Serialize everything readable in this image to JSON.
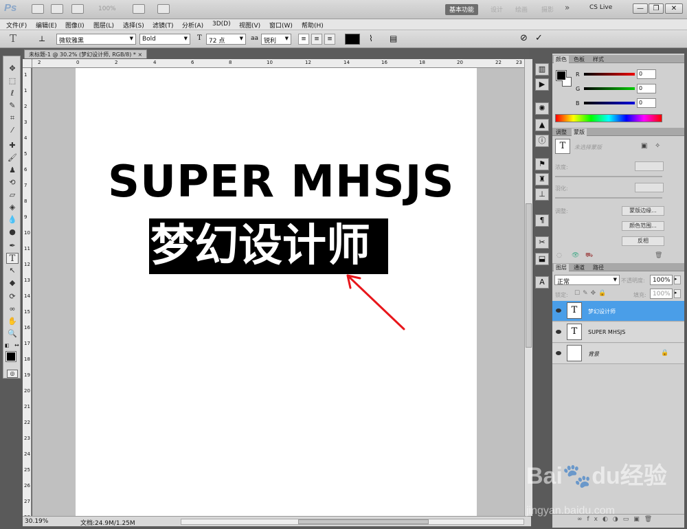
{
  "window": {
    "logo": "Ps",
    "zoom_dropdown": "100%",
    "workspaces": [
      "基本功能",
      "设计",
      "绘画",
      "摄影"
    ],
    "more": "»",
    "cs_live": "CS Live",
    "win_buttons": [
      "—",
      "❐",
      "✕"
    ]
  },
  "menu": [
    "文件(F)",
    "编辑(E)",
    "图像(I)",
    "图层(L)",
    "选择(S)",
    "滤镜(T)",
    "分析(A)",
    "3D(D)",
    "视图(V)",
    "窗口(W)",
    "帮助(H)"
  ],
  "options": {
    "font_family": "微软雅黑",
    "font_style": "Bold",
    "font_size": "72 点",
    "aa_label": "aa",
    "antialias": "锐利",
    "cancel": "⊘",
    "commit": "✓"
  },
  "document": {
    "tab_title": "未标题-1 @ 30.2% (梦幻设计师, RGB/8) *",
    "close": "×",
    "ruler_top": [
      "2",
      "0",
      "2",
      "4",
      "6",
      "8",
      "10",
      "12",
      "14",
      "16",
      "18",
      "20",
      "22",
      "23"
    ],
    "ruler_left": [
      "1",
      "1",
      "2",
      "3",
      "4",
      "5",
      "6",
      "7",
      "8",
      "9",
      "10",
      "11",
      "12",
      "13",
      "14",
      "15",
      "16",
      "17",
      "18",
      "19",
      "20",
      "21",
      "22",
      "23",
      "24",
      "25",
      "26",
      "27",
      "28"
    ],
    "line1": "SUPER MHSJS",
    "line2": "梦幻设计师"
  },
  "status": {
    "zoom": "30.19%",
    "doc_size": "文档:24.9M/1.25M"
  },
  "color_panel": {
    "tabs": [
      "颜色",
      "色板",
      "样式"
    ],
    "channels": [
      {
        "label": "R",
        "value": "0"
      },
      {
        "label": "G",
        "value": "0"
      },
      {
        "label": "B",
        "value": "0"
      }
    ]
  },
  "adjust_panel": {
    "tabs": [
      "调整",
      "蒙版"
    ],
    "mask_hint": "未选择蒙版",
    "density": "浓度:",
    "feather": "羽化:",
    "refine": "调整:",
    "btn_edge": "蒙版边缘...",
    "btn_range": "颜色范围...",
    "btn_invert": "反相"
  },
  "layers_panel": {
    "tabs": [
      "图层",
      "通道",
      "路径"
    ],
    "blend_mode": "正常",
    "opacity_label": "不透明度:",
    "opacity": "100%",
    "lock_label": "锁定:",
    "fill_label": "填充:",
    "fill": "100%",
    "layers": [
      {
        "name": "梦幻设计师",
        "thumb": "T"
      },
      {
        "name": "SUPER MHSJS",
        "thumb": "T"
      },
      {
        "name": "背景",
        "thumb": ""
      }
    ]
  },
  "watermark": {
    "main": "Bai🐾du经验",
    "sub": "jingyan.baidu.com"
  }
}
